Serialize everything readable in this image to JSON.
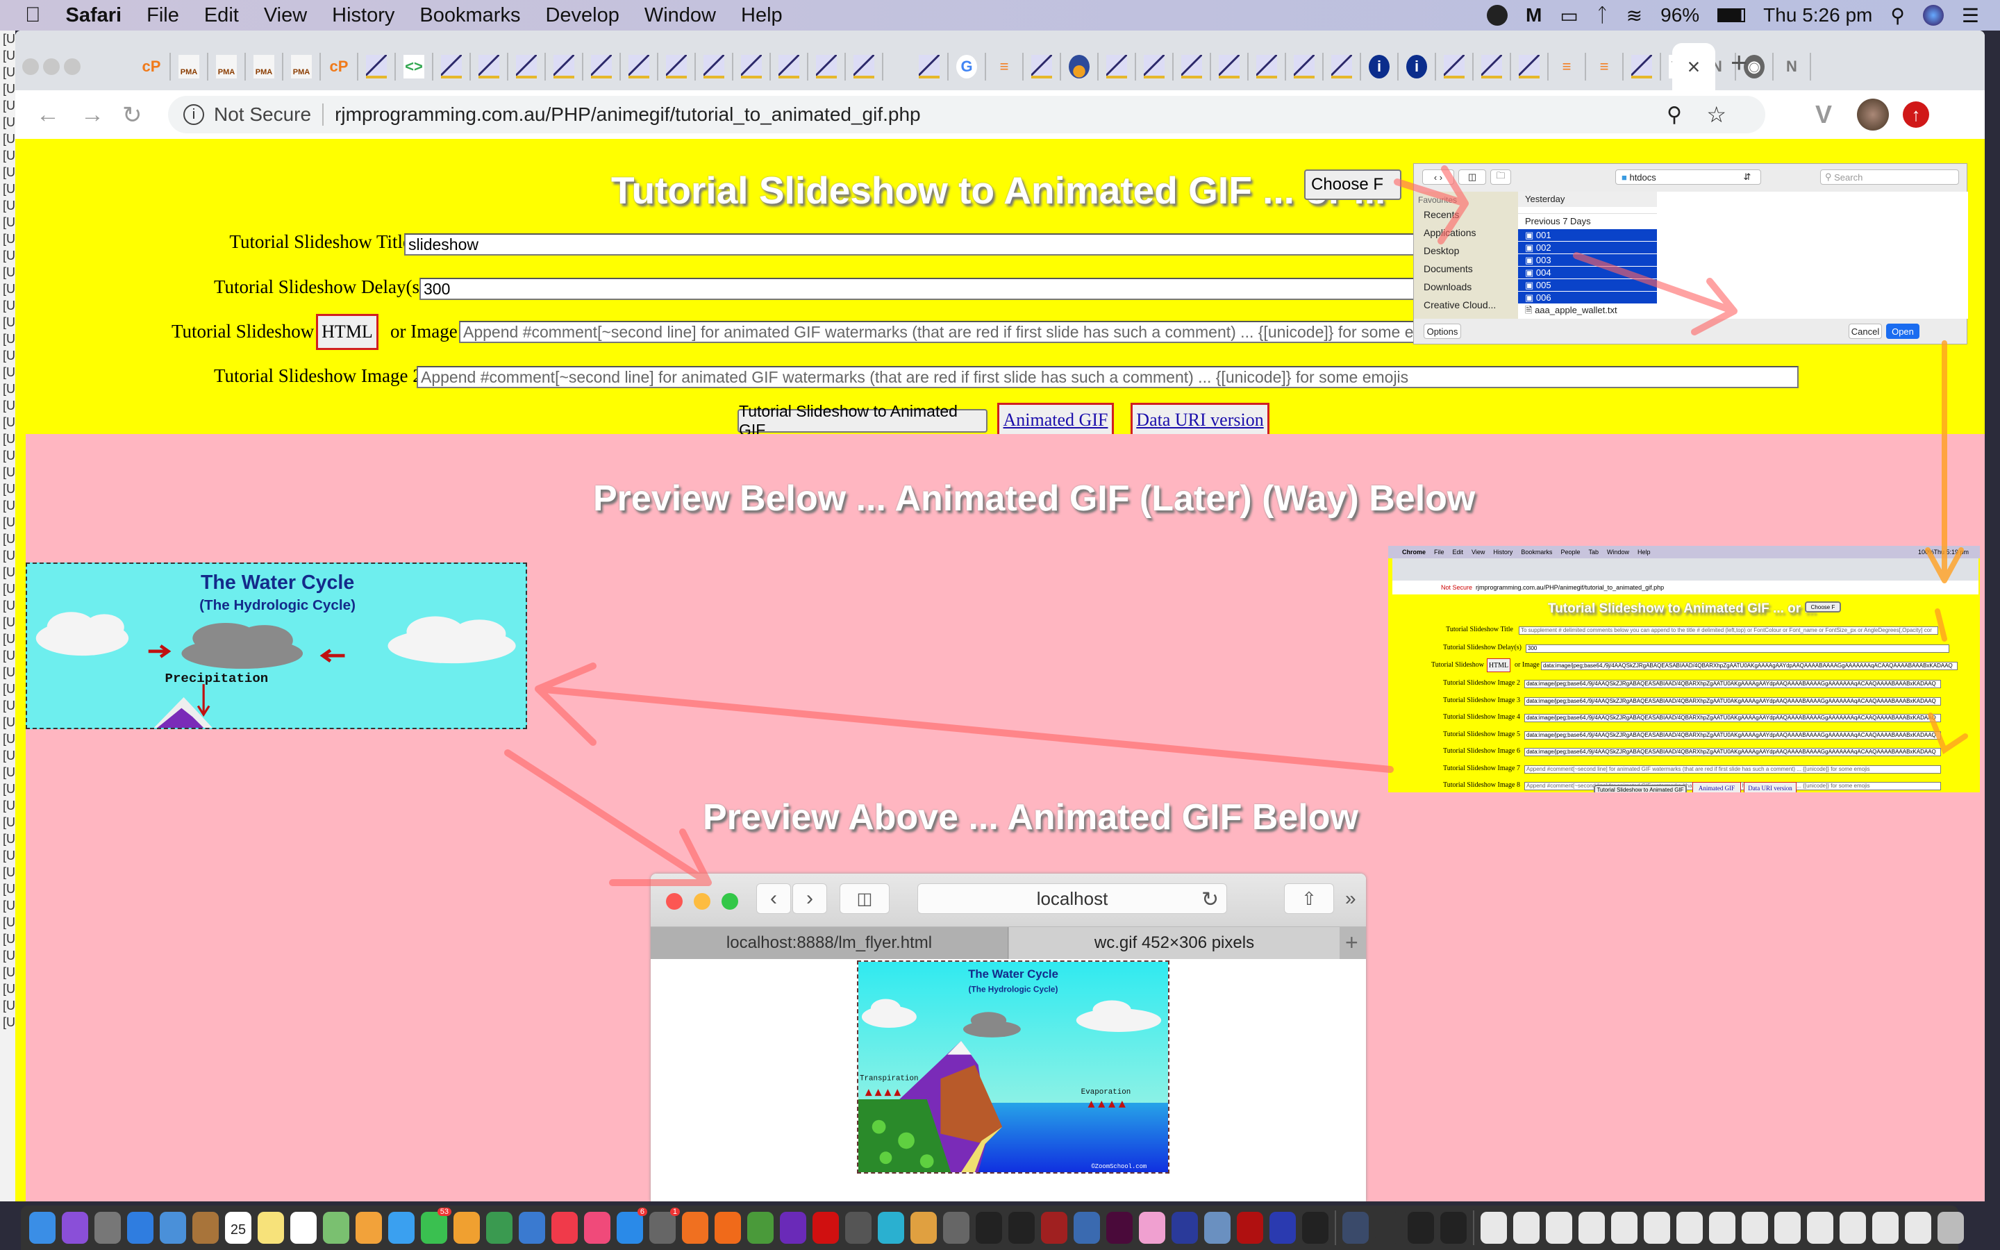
{
  "menubar": {
    "app_name": "Safari",
    "items": [
      "File",
      "Edit",
      "View",
      "History",
      "Bookmarks",
      "Develop",
      "Window",
      "Help"
    ],
    "battery": "96%",
    "clock": "Thu 5:26 pm"
  },
  "browser": {
    "security_label": "Not Secure",
    "url": "rjmprogramming.com.au/PHP/animegif/tutorial_to_animated_gif.php",
    "active_tab_close": "×",
    "new_tab": "+",
    "tab_favicons": [
      "cp",
      "pma",
      "pma",
      "pma",
      "pma",
      "cp",
      "rjm",
      "gdev",
      "rjm",
      "rjm",
      "rjm",
      "rjm",
      "rjm",
      "rjm",
      "rjm",
      "rjm",
      "rjm",
      "rjm",
      "rjm",
      "rjm",
      "gap",
      "rjm",
      "g",
      "so",
      "rjm",
      "circ",
      "rjm",
      "rjm",
      "rjm",
      "rjm",
      "rjm",
      "rjm",
      "rjm",
      "info",
      "info",
      "rjm",
      "rjm",
      "rjm",
      "so",
      "so",
      "rjm",
      "w",
      "n",
      "gh",
      "n"
    ]
  },
  "page": {
    "title": "Tutorial Slideshow to Animated GIF ... or ...",
    "choose_file": "Choose F",
    "title_label": "Tutorial Slideshow Title",
    "title_value": "slideshow",
    "delay_label": "Tutorial Slideshow Delay(s)",
    "delay_value": "300",
    "slideshow_label": "Tutorial Slideshow",
    "html_button": "HTML",
    "or_image": "or Image",
    "image_placeholder": "Append #comment[~second line] for animated GIF watermarks (that are red if first slide has such a comment) ... {[unicode]} for some emojis",
    "image2_label": "Tutorial Slideshow Image 2",
    "convert_button": "Tutorial Slideshow to Animated GIF",
    "animated_gif_link": "Animated GIF",
    "data_uri_link": "Data URI version",
    "preview_below": "Preview Below ... Animated GIF (Later) (Way) Below",
    "preview_above": "Preview Above ... Animated GIF Below"
  },
  "dialog": {
    "location": "htdocs",
    "search_placeholder": "Search",
    "favourites_heading": "Favourites",
    "sidebar": [
      "Recents",
      "Applications",
      "Desktop",
      "Documents",
      "Downloads",
      "Creative Cloud..."
    ],
    "group_yesterday": "Yesterday",
    "group_previous": "Previous 7 Days",
    "selected_files": [
      "001",
      "002",
      "003",
      "004",
      "005",
      "006"
    ],
    "other_file": "aaa_apple_wallet.txt",
    "options": "Options",
    "cancel": "Cancel",
    "open": "Open"
  },
  "water_cycle": {
    "title": "The Water Cycle",
    "subtitle": "(The Hydrologic Cycle)",
    "precipitation": "Precipitation",
    "transpiration": "Transpiration",
    "evaporation": "Evaporation",
    "credit": "©ZoomSchool.com"
  },
  "mini_safari": {
    "address": "localhost",
    "tabs": [
      "localhost:8888/lm_flyer.html",
      "wc.gif 452×306 pixels"
    ]
  },
  "embedded_screenshot": {
    "menu": [
      "Chrome",
      "File",
      "Edit",
      "View",
      "History",
      "Bookmarks",
      "People",
      "Tab",
      "Window",
      "Help"
    ],
    "battery": "100%",
    "clock": "Thu 5:19 pm",
    "security": "Not Secure",
    "url": "rjmprogramming.com.au/PHP/animegif/tutorial_to_animated_gif.php",
    "title": "Tutorial Slideshow to Animated GIF ... or ...",
    "choose": "Choose F",
    "title_label": "Tutorial Slideshow Title",
    "title_placeholder": "To supplement # delimited comments below you can append to the title # delimited (left,top) or FontColour or Font_name or FontSize_px or AngleDegrees[,Opacity] cor",
    "delay_label": "Tutorial Slideshow Delay(s)",
    "delay_value": "300",
    "slideshow_label": "Tutorial Slideshow",
    "html": "HTML",
    "or_image": "or Image",
    "image_value": "data:image/jpeg;base64,/9j/4AAQSkZJRgABAQEASABIAAD/4QBARXhpZgAATU0AKgAAAAgAAYdpAAQAAAABAAAAGgAAAAAAAqACAAQAAAABAAABxKADAAQ",
    "image_rows": [
      {
        "label": "Tutorial Slideshow Image 2",
        "value": "data:image/jpeg;base64,/9j/4AAQSkZJRgABAQEASABIAAD/4QBARXhpZgAATU0AKgAAAAgAAYdpAAQAAAABAAAAGgAAAAAAAqACAAQAAAABAAABxKADAAQ"
      },
      {
        "label": "Tutorial Slideshow Image 3",
        "value": "data:image/jpeg;base64,/9j/4AAQSkZJRgABAQEASABIAAD/4QBARXhpZgAATU0AKgAAAAgAAYdpAAQAAAABAAAAGgAAAAAAAqACAAQAAAABAAABxKADAAQ"
      },
      {
        "label": "Tutorial Slideshow Image 4",
        "value": "data:image/jpeg;base64,/9j/4AAQSkZJRgABAQEASABIAAD/4QBARXhpZgAATU0AKgAAAAgAAYdpAAQAAAABAAAAGgAAAAAAAqACAAQAAAABAAABxKADAAQ"
      },
      {
        "label": "Tutorial Slideshow Image 5",
        "value": "data:image/jpeg;base64,/9j/4AAQSkZJRgABAQEASABIAAD/4QBARXhpZgAATU0AKgAAAAgAAYdpAAQAAAABAAAAGgAAAAAAAqACAAQAAAABAAABxKADAAQ"
      },
      {
        "label": "Tutorial Slideshow Image 6",
        "value": "data:image/jpeg;base64,/9j/4AAQSkZJRgABAQEASABIAAD/4QBARXhpZgAATU0AKgAAAAgAAYdpAAQAAAABAAAAGgAAAAAAAqACAAQAAAABAAABxKADAAQ"
      },
      {
        "label": "Tutorial Slideshow Image 7",
        "value": "Append #comment[~second line] for animated GIF watermarks (that are red if first slide has such a comment) ... {[unicode]} for some emojis"
      },
      {
        "label": "Tutorial Slideshow Image 8",
        "value": "Append #comment[~second line] for animated GIF watermarks (that are red if first slide has such a comment) ... {[unicode]} for some emojis"
      }
    ],
    "convert_button": "Tutorial Slideshow to Animated GIF",
    "animated_gif": "Animated GIF",
    "data_uri": "Data URI version"
  },
  "dock": {
    "apps": [
      "finder",
      "siri",
      "launchpad",
      "safari",
      "mail-stamp",
      "contacts",
      "calendar",
      "notes",
      "reminders",
      "maps",
      "photos",
      "messages",
      "facetime",
      "pages",
      "numbers",
      "keynote",
      "news",
      "music",
      "app-store",
      "system-preferences",
      "avast",
      "firefox",
      "chrome",
      "phpstorm",
      "opera",
      "sequel",
      "filezilla-like",
      "sublime",
      "gimp",
      "terminal",
      "inkscape",
      "photo-booth",
      "r",
      "adobe-xd",
      "sketch",
      "word-press",
      "preview",
      "filezilla",
      "audacity",
      "font",
      "quicktime",
      "printer",
      "console",
      "console",
      "doc",
      "doc",
      "doc",
      "doc",
      "doc",
      "doc",
      "doc",
      "doc",
      "doc",
      "doc",
      "doc",
      "doc",
      "doc",
      "doc",
      "trash"
    ],
    "calendar_day": "25",
    "badges": {
      "facetime": "53",
      "app-store": "6",
      "system-preferences": "1"
    }
  },
  "colors": {
    "page_yellow": "#ffff00",
    "preview_pink": "#ffb6c1",
    "arrow_red": "#ff6464",
    "arrow_orange": "#ffa020",
    "selection_blue": "#0a43c9"
  }
}
